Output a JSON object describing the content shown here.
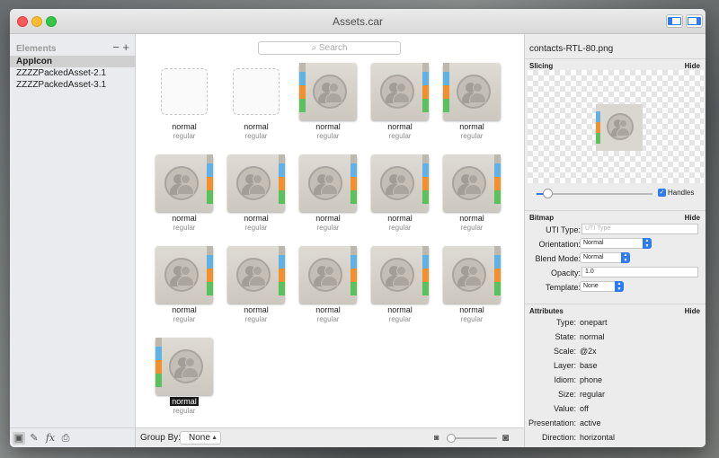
{
  "window": {
    "title": "Assets.car"
  },
  "sidebar": {
    "header": "Elements",
    "tools": "− +",
    "items": [
      {
        "label": "AppIcon",
        "selected": true
      },
      {
        "label": "ZZZZPackedAsset-2.1",
        "selected": false
      },
      {
        "label": "ZZZZPackedAsset-3.1",
        "selected": false
      }
    ],
    "footer_icons": [
      "image-icon",
      "eyedropper-icon",
      "fx-icon",
      "printer-icon"
    ]
  },
  "search": {
    "placeholder": "Search"
  },
  "grid": {
    "items": [
      {
        "name": "normal",
        "sub": "regular",
        "kind": "empty"
      },
      {
        "name": "normal",
        "sub": "regular",
        "kind": "empty"
      },
      {
        "name": "normal",
        "sub": "regular",
        "kind": "book-left"
      },
      {
        "name": "normal",
        "sub": "regular",
        "kind": "book-right"
      },
      {
        "name": "normal",
        "sub": "regular",
        "kind": "book-left"
      },
      {
        "name": "normal",
        "sub": "regular",
        "kind": "book-right"
      },
      {
        "name": "normal",
        "sub": "regular",
        "kind": "book-right"
      },
      {
        "name": "normal",
        "sub": "regular",
        "kind": "book-right"
      },
      {
        "name": "normal",
        "sub": "regular",
        "kind": "book-right"
      },
      {
        "name": "normal",
        "sub": "regular",
        "kind": "book-right"
      },
      {
        "name": "normal",
        "sub": "regular",
        "kind": "book-right"
      },
      {
        "name": "normal",
        "sub": "regular",
        "kind": "book-right"
      },
      {
        "name": "normal",
        "sub": "regular",
        "kind": "book-right"
      },
      {
        "name": "normal",
        "sub": "regular",
        "kind": "book-right"
      },
      {
        "name": "normal",
        "sub": "regular",
        "kind": "book-right"
      },
      {
        "name": "normal",
        "sub": "regular",
        "kind": "book-left",
        "selected": true
      }
    ]
  },
  "footer": {
    "group_by_label": "Group By:",
    "group_by_value": "None",
    "zoom_level": 0.0
  },
  "inspector": {
    "title": "contacts-RTL-80.png",
    "slicing": {
      "label": "Slicing",
      "hide": "Hide",
      "handles_label": "Handles",
      "handles_checked": true
    },
    "bitmap": {
      "label": "Bitmap",
      "hide": "Hide",
      "uti_label": "UTI Type:",
      "uti_placeholder": "UTI Type",
      "orientation_label": "Orientation:",
      "orientation_value": "Normal",
      "blend_label": "Blend Mode:",
      "blend_value": "Normal",
      "opacity_label": "Opacity:",
      "opacity_value": "1.0",
      "template_label": "Template:",
      "template_value": "None"
    },
    "attributes": {
      "label": "Attributes",
      "hide": "Hide",
      "rows": [
        {
          "label": "Type:",
          "value": "onepart"
        },
        {
          "label": "State:",
          "value": "normal"
        },
        {
          "label": "Scale:",
          "value": "@2x"
        },
        {
          "label": "Layer:",
          "value": "base"
        },
        {
          "label": "Idiom:",
          "value": "phone"
        },
        {
          "label": "Size:",
          "value": "regular"
        },
        {
          "label": "Value:",
          "value": "off"
        },
        {
          "label": "Presentation:",
          "value": "active"
        },
        {
          "label": "Direction:",
          "value": "horizontal"
        }
      ]
    }
  },
  "colors": {
    "accent": "#2d7bf2",
    "tab_blue": "#5fb1e6",
    "tab_orange": "#f0912d",
    "tab_green": "#5bc15d"
  }
}
